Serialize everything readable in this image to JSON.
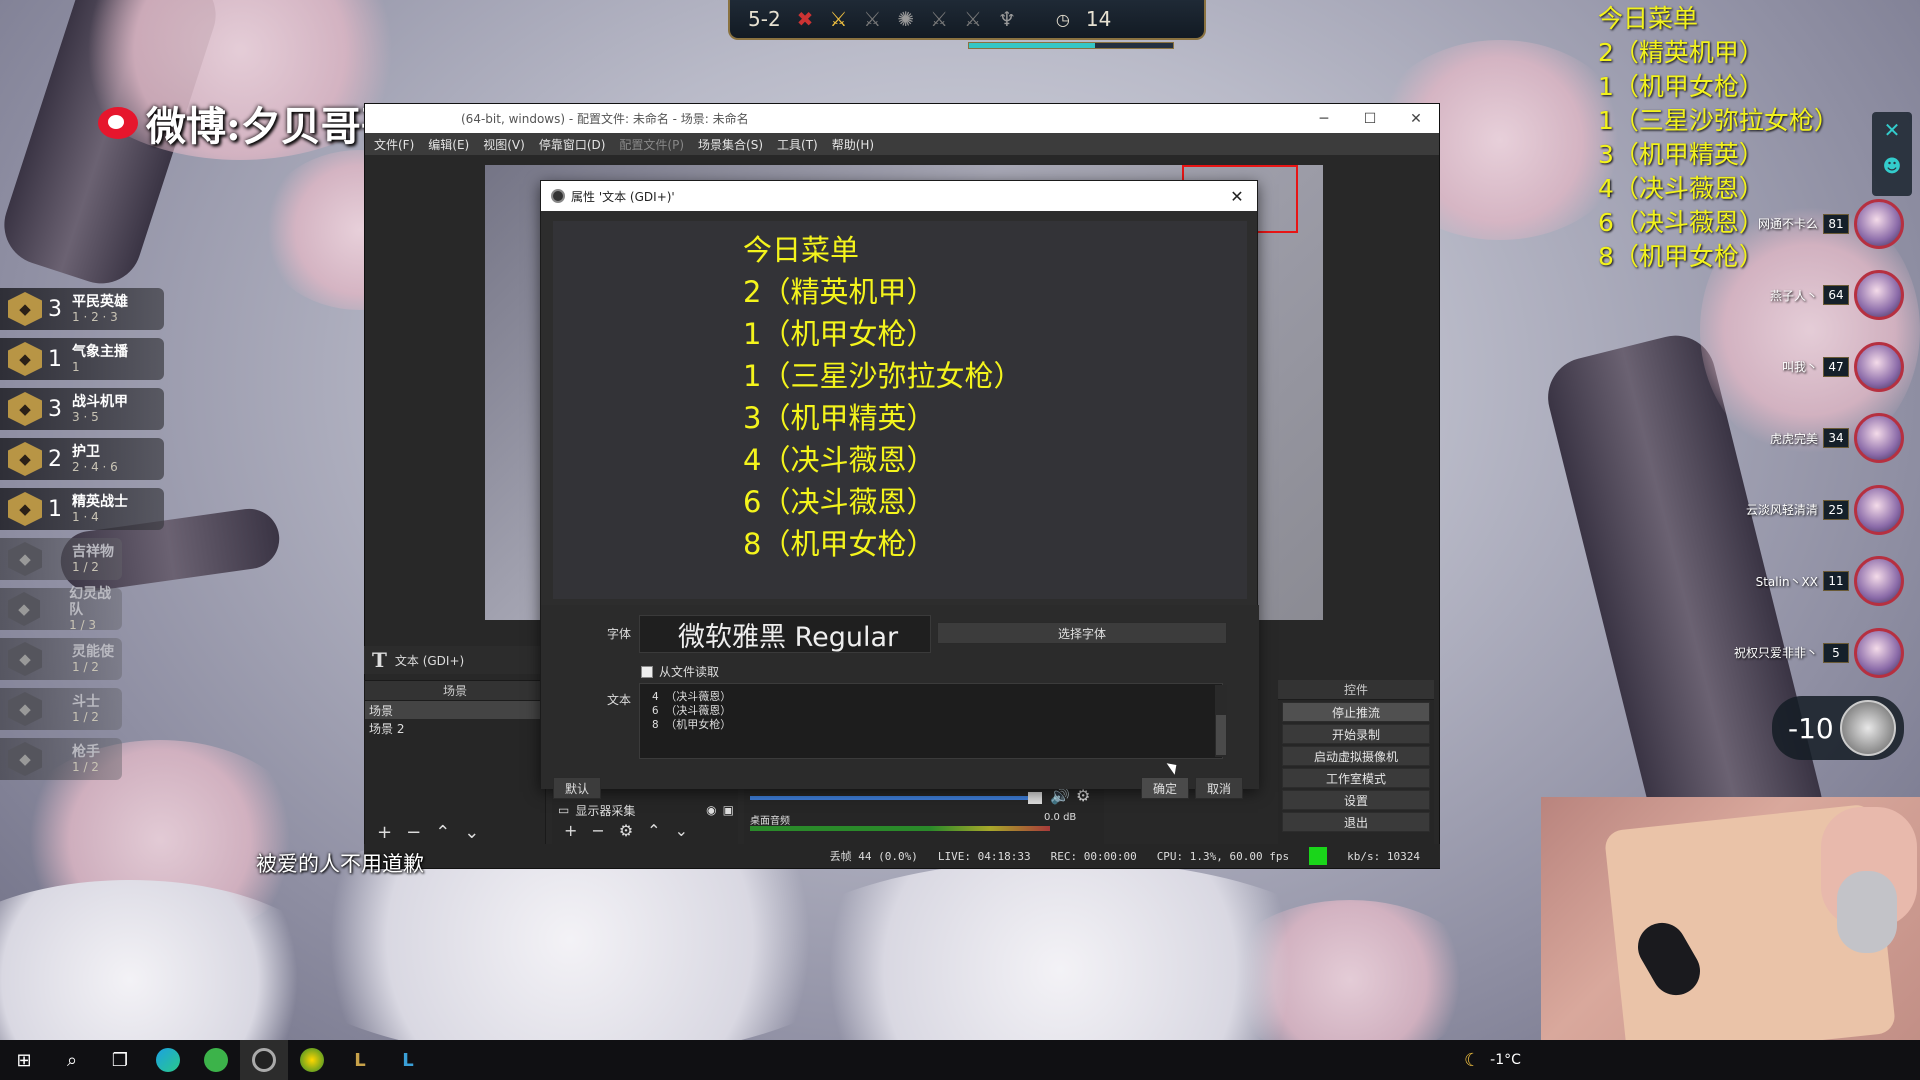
{
  "hud": {
    "stage": "5-2",
    "timer": "14",
    "round_progress": 0.62
  },
  "watermark": {
    "text": "微博:夕贝哥哥呀"
  },
  "traits": [
    {
      "count": "3",
      "name": "平民英雄",
      "tiers": "1 · 2 · 3",
      "active": true
    },
    {
      "count": "1",
      "name": "气象主播",
      "tiers": "1",
      "active": true
    },
    {
      "count": "3",
      "name": "战斗机甲",
      "tiers": "3 · 5",
      "active": true
    },
    {
      "count": "2",
      "name": "护卫",
      "tiers": "2 · 4 · 6",
      "active": true
    },
    {
      "count": "1",
      "name": "精英战士",
      "tiers": "1 · 4",
      "active": true
    },
    {
      "count": "",
      "name": "吉祥物",
      "tiers": "1 / 2",
      "active": false
    },
    {
      "count": "",
      "name": "幻灵战队",
      "tiers": "1 / 3",
      "active": false
    },
    {
      "count": "",
      "name": "灵能使",
      "tiers": "1 / 2",
      "active": false
    },
    {
      "count": "",
      "name": "斗士",
      "tiers": "1 / 2",
      "active": false
    },
    {
      "count": "",
      "name": "枪手",
      "tiers": "1 / 2",
      "active": false
    }
  ],
  "menu_overlay": {
    "title": "今日菜单",
    "lines": [
      "2（精英机甲）",
      "1（机甲女枪）",
      "1（三星沙弥拉女枪）",
      "3（机甲精英）",
      "4（决斗薇恩）",
      "6（决斗薇恩）",
      "8（机甲女枪）"
    ]
  },
  "players": [
    {
      "name": "网通不卡么",
      "hp": "81"
    },
    {
      "name": "燕子人丶",
      "hp": "64"
    },
    {
      "name": "叫我丶",
      "hp": "47"
    },
    {
      "name": "虎虎完美",
      "hp": "34"
    },
    {
      "name": "云淡风轻清清",
      "hp": "25"
    },
    {
      "name": "Stalin丶XX",
      "hp": "11"
    },
    {
      "name": "祝权只爱非非丶",
      "hp": "5"
    }
  ],
  "gold_change": "-10",
  "subtitle": "被爱的人不用道歉",
  "obs": {
    "title": "(64-bit, windows) - 配置文件: 未命名 - 场景: 未命名",
    "menu": [
      "文件(F)",
      "编辑(E)",
      "视图(V)",
      "停靠窗口(D)",
      "配置文件(P)",
      "场景集合(S)",
      "工具(T)",
      "帮助(H)"
    ],
    "source_label": "文本 (GDI+)",
    "scenes_header": "场景",
    "scenes": [
      "场景",
      "场景 2"
    ],
    "source_item": "显示器采集",
    "mixer_label": "桌面音频",
    "mixer_db": "0.0 dB",
    "controls_header": "控件",
    "controls": [
      "停止推流",
      "开始录制",
      "启动虚拟摄像机",
      "工作室模式",
      "设置",
      "退出"
    ],
    "status": {
      "dropped": "丢帧 44 (0.0%)",
      "live": "LIVE: 04:18:33",
      "rec": "REC: 00:00:00",
      "cpu": "CPU: 1.3%, 60.00 fps",
      "kbps": "kb/s: 10324"
    }
  },
  "dialog": {
    "title": "属性 '文本 (GDI+)'",
    "preview_title": "今日菜单",
    "preview_lines": [
      "2（精英机甲）",
      "1（机甲女枪）",
      "1（三星沙弥拉女枪）",
      "3（机甲精英）",
      "4（决斗薇恩）",
      "6（决斗薇恩）",
      "8（机甲女枪）"
    ],
    "font_label": "字体",
    "font_value": "微软雅黑 Regular",
    "choose_font": "选择字体",
    "from_file": "从文件读取",
    "text_label": "文本",
    "text_value": "4 （决斗薇恩）\n6 （决斗薇恩）\n8 （机甲女枪）",
    "default_btn": "默认",
    "ok_btn": "确定",
    "cancel_btn": "取消"
  },
  "tray": {
    "temp": "-1°C"
  },
  "colors": {
    "overlay_text": "#f2f21c",
    "obs_bg": "#282828",
    "stream_ok": "#1ad51a"
  }
}
